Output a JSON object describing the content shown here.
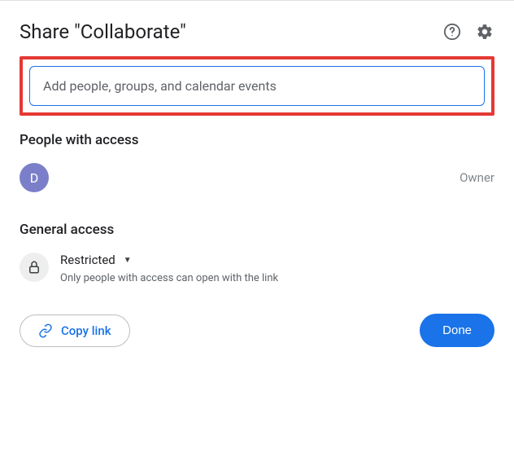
{
  "header": {
    "title": "Share \"Collaborate\""
  },
  "input": {
    "placeholder": "Add people, groups, and calendar events",
    "value": ""
  },
  "sections": {
    "people_title": "People with access",
    "general_title": "General access"
  },
  "people": [
    {
      "initial": "D",
      "role": "Owner"
    }
  ],
  "general": {
    "label": "Restricted",
    "description": "Only people with access can open with the link"
  },
  "footer": {
    "copy_link": "Copy link",
    "done": "Done"
  }
}
